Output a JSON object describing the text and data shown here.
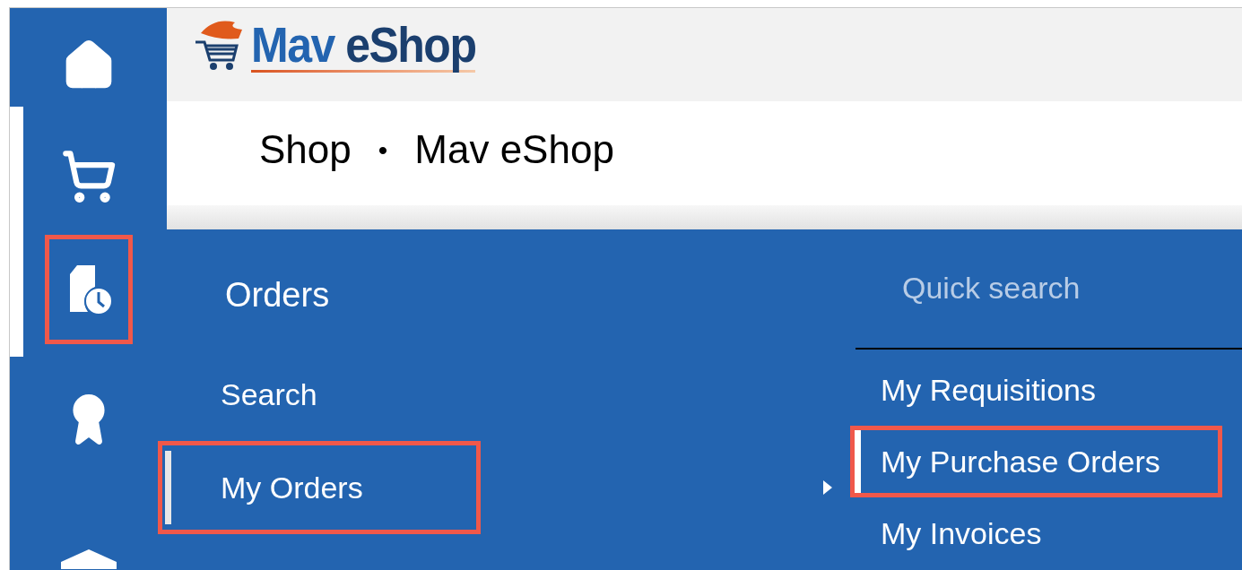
{
  "sidebar": {
    "items": [
      {
        "selected": false,
        "annotated": false
      },
      {
        "selected": false,
        "annotated": false
      },
      {
        "selected": true,
        "annotated": true
      },
      {
        "selected": false,
        "annotated": false
      },
      {
        "selected": false,
        "annotated": false
      }
    ]
  },
  "logo": {
    "words": [
      "Mav",
      "eShop"
    ]
  },
  "breadcrumb": [
    "Shop",
    "•",
    "Mav eShop"
  ],
  "menu": {
    "title": "Orders",
    "items": [
      {
        "label": "Search",
        "selected": false,
        "annotated": false
      },
      {
        "label": "My Orders",
        "selected": true,
        "annotated": true
      }
    ],
    "quick_search": {
      "placeholder": "Quick search"
    },
    "subitems": [
      {
        "label": "My Requisitions",
        "selected": false,
        "annotated": false
      },
      {
        "label": "My Purchase Orders",
        "selected": true,
        "annotated": true
      },
      {
        "label": "My Invoices",
        "selected": false,
        "annotated": false
      }
    ]
  }
}
